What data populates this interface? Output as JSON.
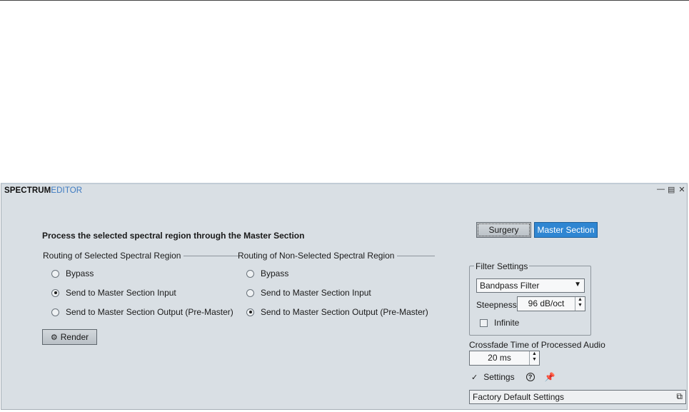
{
  "window": {
    "title_bold": "SPECTRUM",
    "title_light": "EDITOR",
    "controls": [
      "minimize-icon",
      "menu-icon",
      "close-icon"
    ]
  },
  "main": {
    "heading": "Process the selected spectral region through the Master Section",
    "selected_group": {
      "title": "Routing of Selected Spectral Region",
      "options": [
        {
          "label": "Bypass",
          "checked": false
        },
        {
          "label": "Send to Master Section Input",
          "checked": true
        },
        {
          "label": "Send to Master Section Output (Pre-Master)",
          "checked": false
        }
      ]
    },
    "nonselected_group": {
      "title": "Routing of Non-Selected Spectral Region",
      "options": [
        {
          "label": "Bypass",
          "checked": false
        },
        {
          "label": "Send to Master Section Input",
          "checked": false
        },
        {
          "label": "Send to Master Section Output (Pre-Master)",
          "checked": true
        }
      ]
    },
    "render_label": "Render"
  },
  "tabs": {
    "surgery": "Surgery",
    "master_section": "Master Section"
  },
  "filter": {
    "legend": "Filter Settings",
    "type_value": "Bandpass Filter",
    "steepness_label": "Steepness",
    "steepness_value": "96 dB/oct",
    "infinite_label": "Infinite",
    "infinite_checked": false
  },
  "crossfade": {
    "label": "Crossfade Time of Processed Audio",
    "value": "20 ms"
  },
  "settings": {
    "label": "Settings",
    "help_glyph": "?",
    "preset_value": "Factory Default Settings"
  },
  "colors": {
    "panel_bg": "#d9dfe4",
    "accent_blue": "#2f86d2",
    "title_blue": "#3f7bc1"
  }
}
